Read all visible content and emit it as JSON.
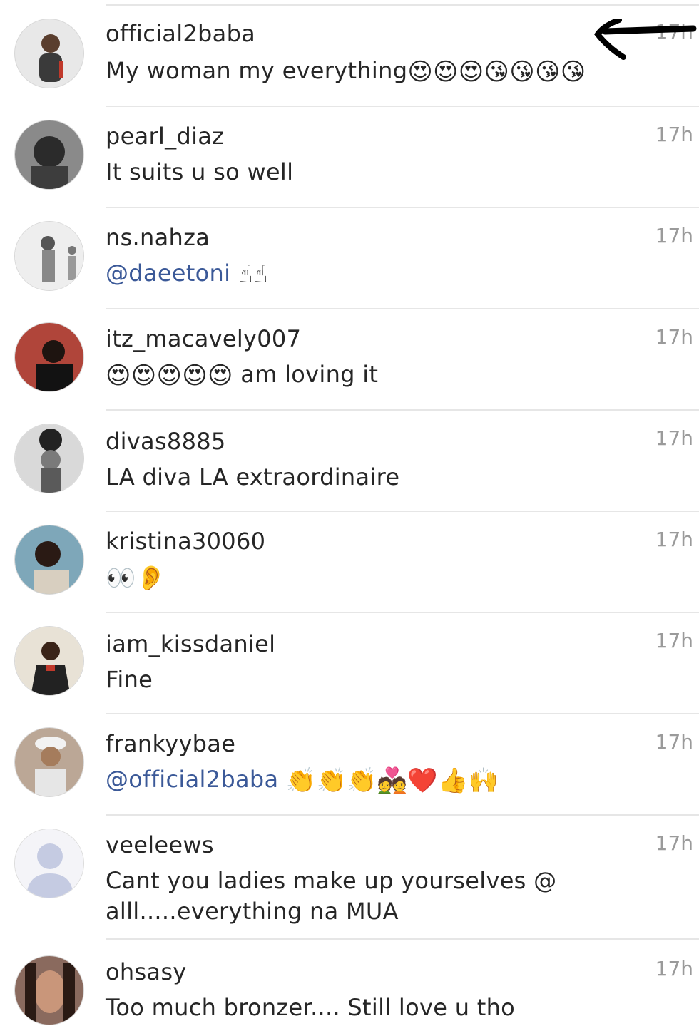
{
  "comments": [
    {
      "username": "official2baba",
      "time": "17h",
      "text": "My woman my everything",
      "emojis": "😍😍😍😘😘😘😘",
      "avatar_color": "#c9c9c9"
    },
    {
      "username": "pearl_diaz",
      "time": "17h",
      "text": "It suits u so well",
      "avatar_color": "#6b6b6b"
    },
    {
      "username": "ns.nahza",
      "time": "17h",
      "mention": "@daeetoni",
      "emojis": "☝☝",
      "avatar_color": "#d6d6d6"
    },
    {
      "username": "itz_macavely007",
      "time": "17h",
      "emojis": "😍😍😍😍😍",
      "text": "am loving it",
      "avatar_color": "#b0453a"
    },
    {
      "username": "divas8885",
      "time": "17h",
      "text": "LA diva LA extraordinaire",
      "avatar_color": "#9c9c9c"
    },
    {
      "username": "kristina30060",
      "time": "17h",
      "emojis": "👀👂",
      "avatar_color": "#7ea7b9"
    },
    {
      "username": "iam_kissdaniel",
      "time": "17h",
      "text": "Fine",
      "avatar_color": "#6a5a4a"
    },
    {
      "username": "frankyybae",
      "time": "17h",
      "mention": "@official2baba",
      "emojis": "👏👏👏💑❤️👍🙌",
      "avatar_color": "#bba796"
    },
    {
      "username": "veeleews",
      "time": "17h",
      "text": "Cant you ladies make up yourselves @ alll.....everything na MUA",
      "avatar_color": "#c5cbe2"
    },
    {
      "username": "ohsasy",
      "time": "17h",
      "text": "Too much bronzer.... Still love u tho",
      "avatar_color": "#8a6a5e"
    }
  ]
}
